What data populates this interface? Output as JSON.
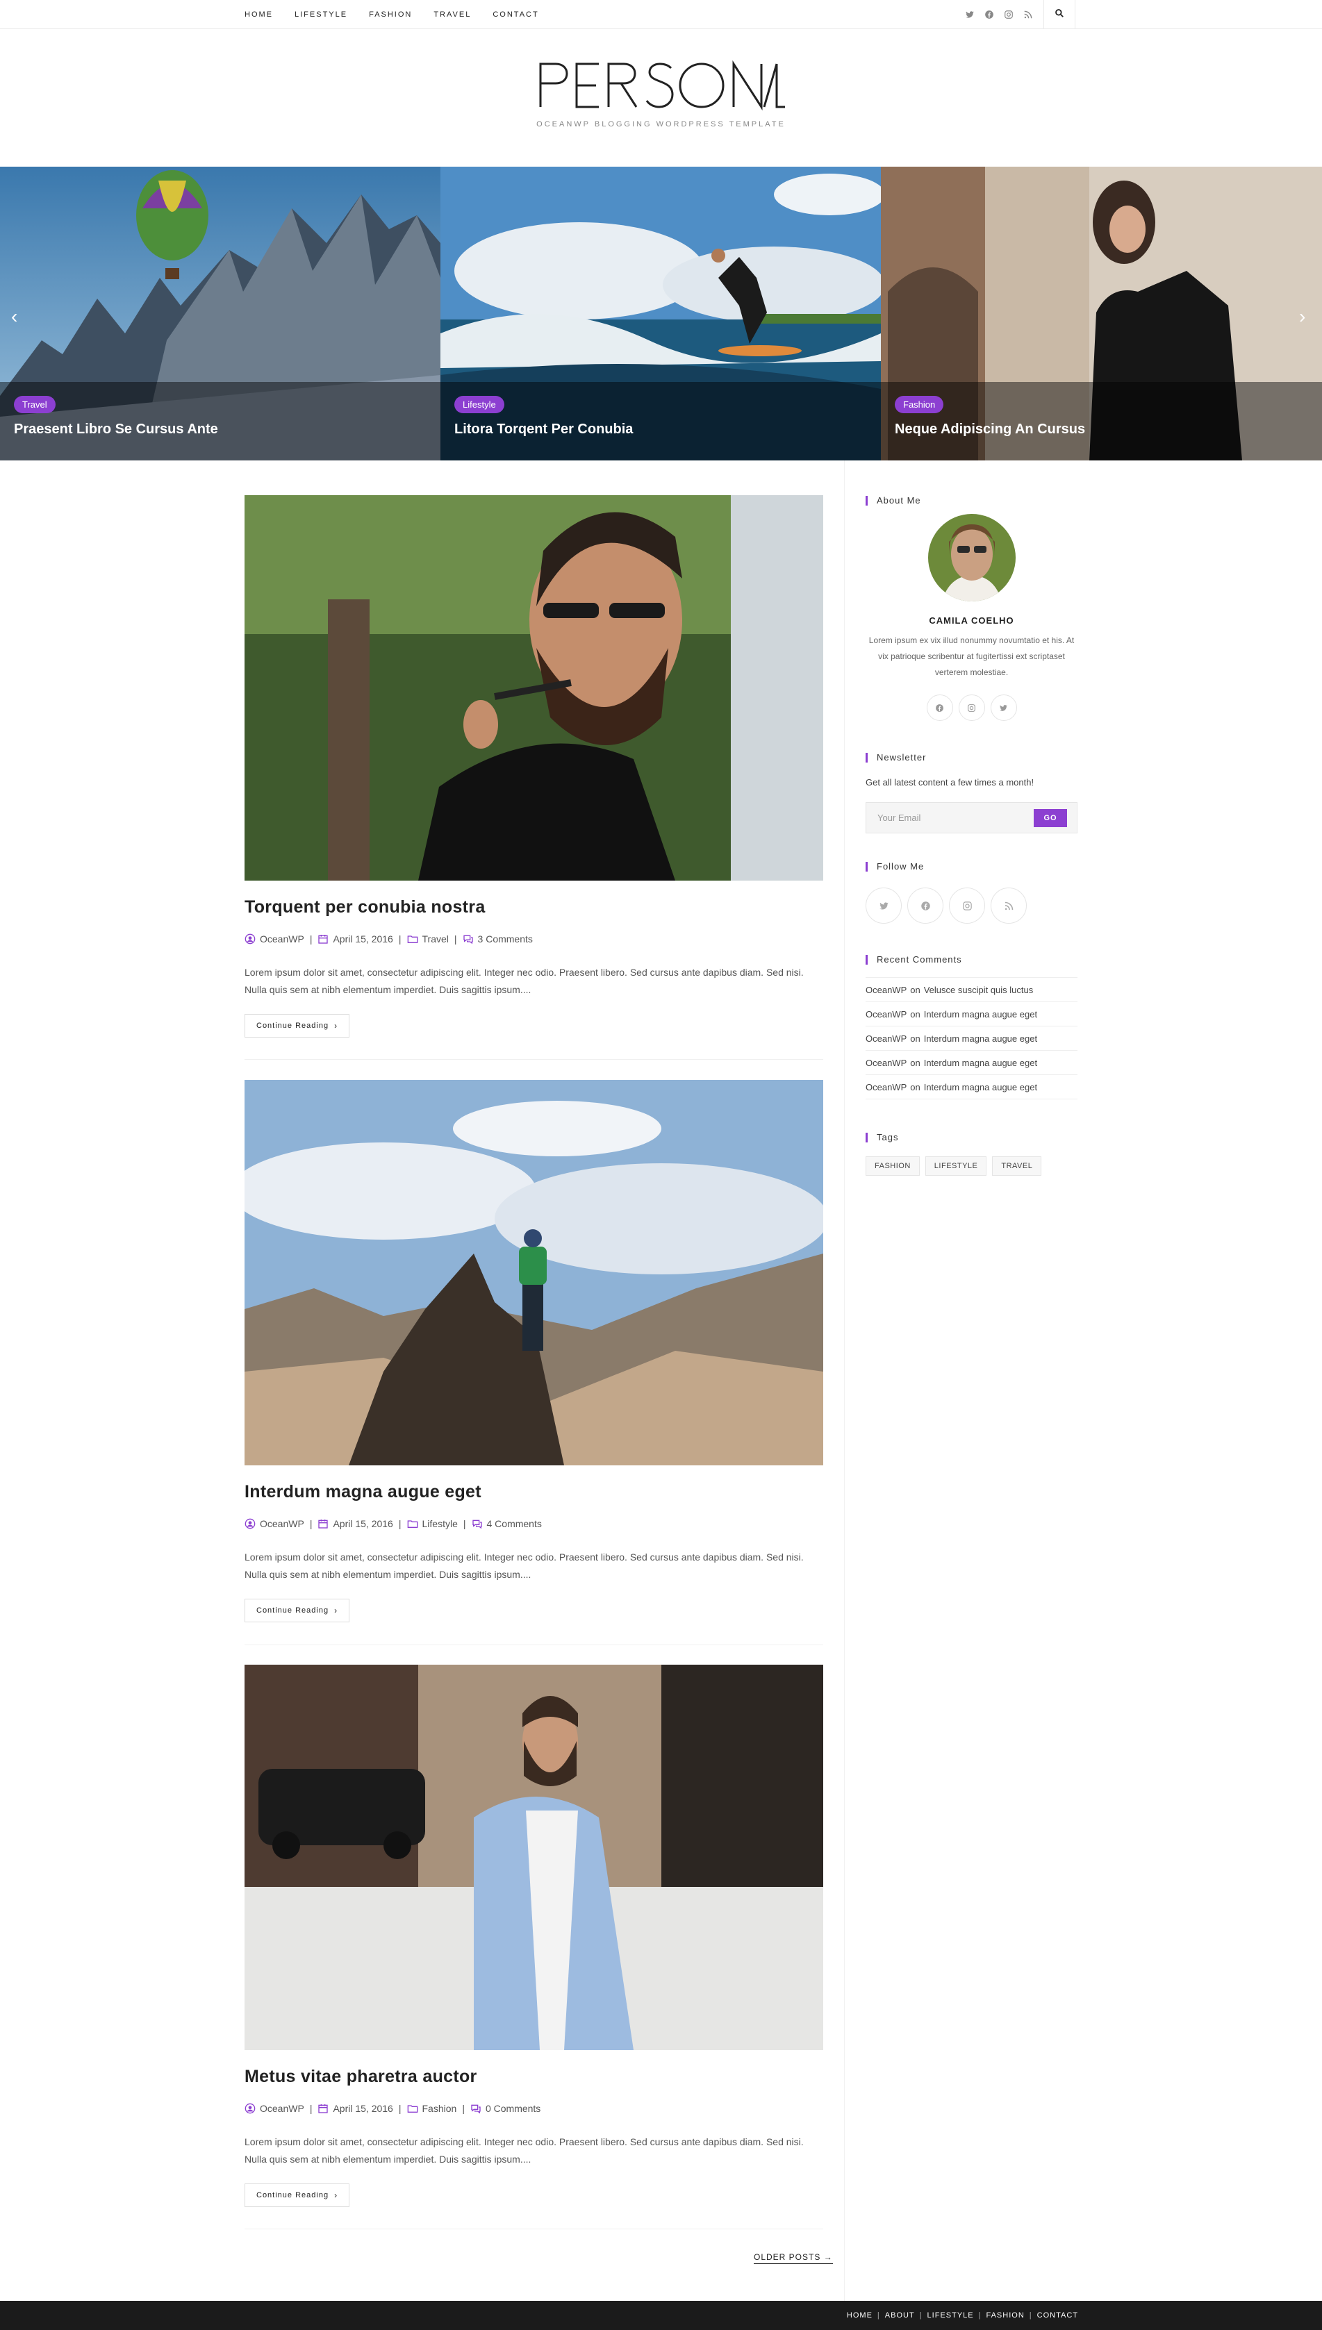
{
  "nav": [
    "HOME",
    "LIFESTYLE",
    "FASHION",
    "TRAVEL",
    "CONTACT"
  ],
  "social_top": [
    "twitter-icon",
    "facebook-icon",
    "instagram-icon",
    "rss-icon"
  ],
  "header": {
    "logo": "PERSONAL",
    "tagline": "OCEANWP BLOGGING WORDPRESS TEMPLATE"
  },
  "slides": [
    {
      "category": "Travel",
      "title": "Praesent Libro Se Cursus Ante"
    },
    {
      "category": "Lifestyle",
      "title": "Litora Torqent Per Conubia"
    },
    {
      "category": "Fashion",
      "title": "Neque Adipiscing An Cursus"
    }
  ],
  "posts": [
    {
      "title": "Torquent per conubia nostra",
      "author": "OceanWP",
      "date": "April 15, 2016",
      "category": "Travel",
      "comments": "3 Comments",
      "excerpt": "Lorem ipsum dolor sit amet, consectetur adipiscing elit. Integer nec odio. Praesent libero. Sed cursus ante dapibus diam. Sed nisi. Nulla quis sem at nibh elementum imperdiet. Duis sagittis ipsum....",
      "cta": "Continue Reading"
    },
    {
      "title": "Interdum magna augue eget",
      "author": "OceanWP",
      "date": "April 15, 2016",
      "category": "Lifestyle",
      "comments": "4 Comments",
      "excerpt": "Lorem ipsum dolor sit amet, consectetur adipiscing elit. Integer nec odio. Praesent libero. Sed cursus ante dapibus diam. Sed nisi. Nulla quis sem at nibh elementum imperdiet. Duis sagittis ipsum....",
      "cta": "Continue Reading"
    },
    {
      "title": "Metus vitae pharetra auctor",
      "author": "OceanWP",
      "date": "April 15, 2016",
      "category": "Fashion",
      "comments": "0 Comments",
      "excerpt": "Lorem ipsum dolor sit amet, consectetur adipiscing elit. Integer nec odio. Praesent libero. Sed cursus ante dapibus diam. Sed nisi. Nulla quis sem at nibh elementum imperdiet. Duis sagittis ipsum....",
      "cta": "Continue Reading"
    }
  ],
  "sidebar": {
    "about": {
      "title": "About Me",
      "name": "CAMILA COELHO",
      "text": "Lorem ipsum ex vix illud nonummy novumtatio et his. At vix patrioque scribentur at fugitertissi ext scriptaset verterem molestiae.",
      "social": [
        "facebook-icon",
        "instagram-icon",
        "twitter-icon"
      ]
    },
    "newsletter": {
      "title": "Newsletter",
      "text": "Get all latest content a few times a month!",
      "placeholder": "Your Email",
      "button": "GO"
    },
    "follow": {
      "title": "Follow Me",
      "icons": [
        "twitter-icon",
        "facebook-icon",
        "instagram-icon",
        "rss-icon"
      ]
    },
    "recent_comments": {
      "title": "Recent Comments",
      "on_word": "on",
      "items": [
        {
          "author": "OceanWP",
          "post": "Velusce suscipit quis luctus"
        },
        {
          "author": "OceanWP",
          "post": "Interdum magna augue eget"
        },
        {
          "author": "OceanWP",
          "post": "Interdum magna augue eget"
        },
        {
          "author": "OceanWP",
          "post": "Interdum magna augue eget"
        },
        {
          "author": "OceanWP",
          "post": "Interdum magna augue eget"
        }
      ]
    },
    "tags": {
      "title": "Tags",
      "items": [
        "FASHION",
        "LIFESTYLE",
        "TRAVEL"
      ]
    }
  },
  "pagination": {
    "older": "OLDER POSTS →"
  },
  "footer": {
    "nav": [
      "HOME",
      "ABOUT",
      "LIFESTYLE",
      "FASHION",
      "CONTACT"
    ]
  },
  "colors": {
    "accent": "#8c3fd1",
    "footer_bg": "#1b1b1b"
  }
}
